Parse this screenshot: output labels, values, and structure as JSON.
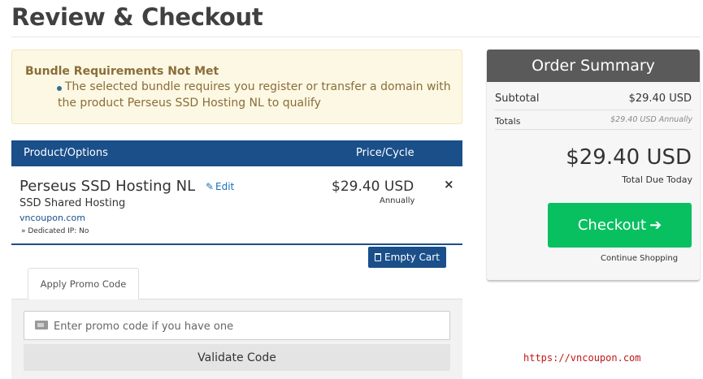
{
  "page": {
    "title": "Review & Checkout"
  },
  "alert": {
    "title": "Bundle Requirements Not Met",
    "message_line1": "The selected bundle requires you register or transfer a domain with",
    "message_line2": "the product Perseus SSD Hosting NL to qualify",
    "color": "#8a6d3b",
    "background": "#fcf8e3"
  },
  "cart": {
    "headers": {
      "product": "Product/Options",
      "price": "Price/Cycle"
    },
    "header_color": "#1a4f8a",
    "items": [
      {
        "name": "Perseus SSD Hosting NL",
        "edit_label": "Edit",
        "group": "SSD Shared Hosting",
        "domain": "vncoupon.com",
        "option": "» Dedicated IP: No",
        "price": "$29.40 USD",
        "cycle": "Annually",
        "remove_label": "×"
      }
    ],
    "empty_cart_label": "Empty Cart"
  },
  "promo": {
    "tab_label": "Apply Promo Code",
    "input_placeholder": "Enter promo code if you have one",
    "input_value": "",
    "validate_label": "Validate Code"
  },
  "summary": {
    "title": "Order Summary",
    "subtotal_label": "Subtotal",
    "subtotal_value": "$29.40 USD",
    "totals_label": "Totals",
    "totals_value": "$29.40 USD Annually",
    "grand_total": "$29.40 USD",
    "total_due_label": "Total Due Today",
    "checkout_label": "Checkout",
    "checkout_icon": "arrow-right-icon",
    "checkout_color": "#08c060",
    "continue_label": "Continue Shopping"
  },
  "watermark": {
    "text": "https://vncoupon.com",
    "color": "#c01818"
  }
}
